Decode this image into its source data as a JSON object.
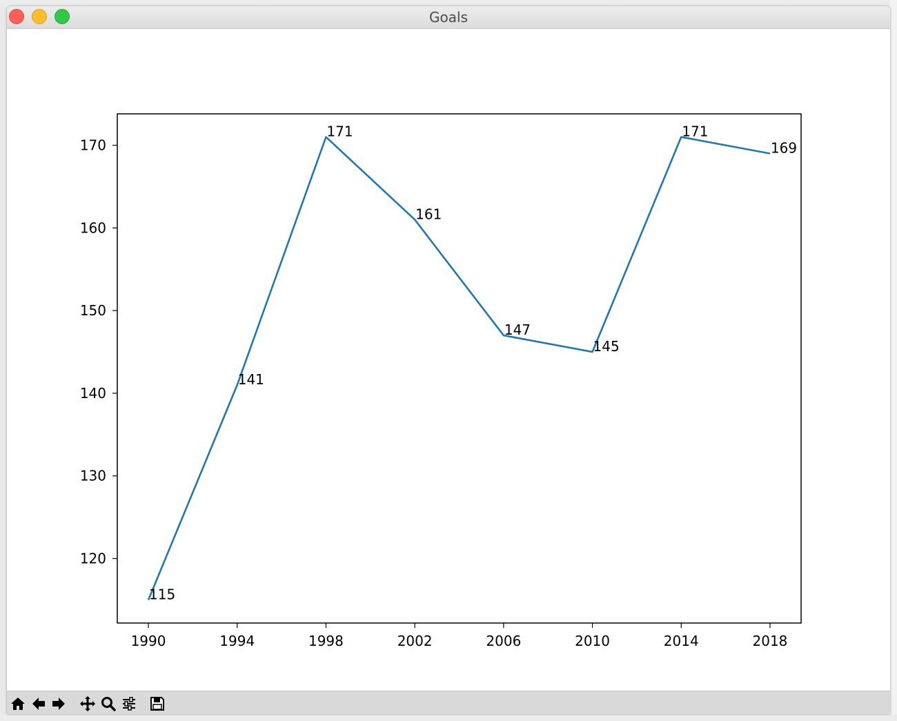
{
  "window": {
    "title": "Goals"
  },
  "toolbar": {
    "buttons": [
      {
        "icon": "home-icon"
      },
      {
        "icon": "back-arrow-icon"
      },
      {
        "icon": "forward-arrow-icon"
      },
      {
        "icon": "pan-icon"
      },
      {
        "icon": "zoom-icon"
      },
      {
        "icon": "configure-subplots-icon"
      },
      {
        "icon": "save-icon"
      }
    ]
  },
  "chart_data": {
    "type": "line",
    "title": "",
    "xlabel": "",
    "ylabel": "",
    "x": [
      1990,
      1994,
      1998,
      2002,
      2006,
      2010,
      2014,
      2018
    ],
    "x_tick_labels": [
      "1990",
      "1994",
      "1998",
      "2002",
      "2006",
      "2010",
      "2014",
      "2018"
    ],
    "series": [
      {
        "values": [
          115,
          141,
          171,
          161,
          147,
          145,
          171,
          169
        ],
        "color": "#1f77b4"
      }
    ],
    "data_labels": [
      "115",
      "141",
      "171",
      "161",
      "147",
      "145",
      "171",
      "169"
    ],
    "y_ticks": [
      120,
      130,
      140,
      150,
      160,
      170
    ],
    "y_tick_labels": [
      "120",
      "130",
      "140",
      "150",
      "160",
      "170"
    ],
    "xlim": [
      1988.6,
      2019.4
    ],
    "ylim": [
      112.2,
      173.8
    ],
    "grid": false,
    "legend": "none"
  }
}
